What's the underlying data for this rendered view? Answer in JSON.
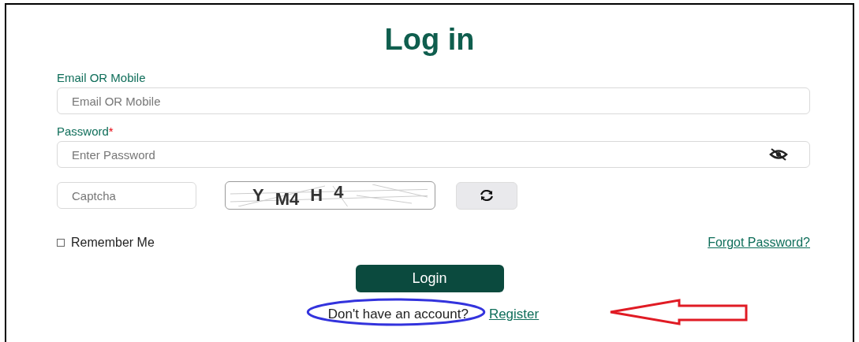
{
  "title": "Log in",
  "email": {
    "label": "Email OR Mobile",
    "placeholder": "Email OR Mobile"
  },
  "password": {
    "label": "Password",
    "required_mark": "*",
    "placeholder": "Enter Password"
  },
  "captcha": {
    "placeholder": "Captcha",
    "glyphs": [
      "Y",
      "M4",
      "H",
      "4"
    ]
  },
  "remember": {
    "label": "Remember Me",
    "checked": false
  },
  "forgot_link": "Forgot Password?",
  "login_button": "Login",
  "register_prompt": "Don't have an account?",
  "register_link": "Register"
}
